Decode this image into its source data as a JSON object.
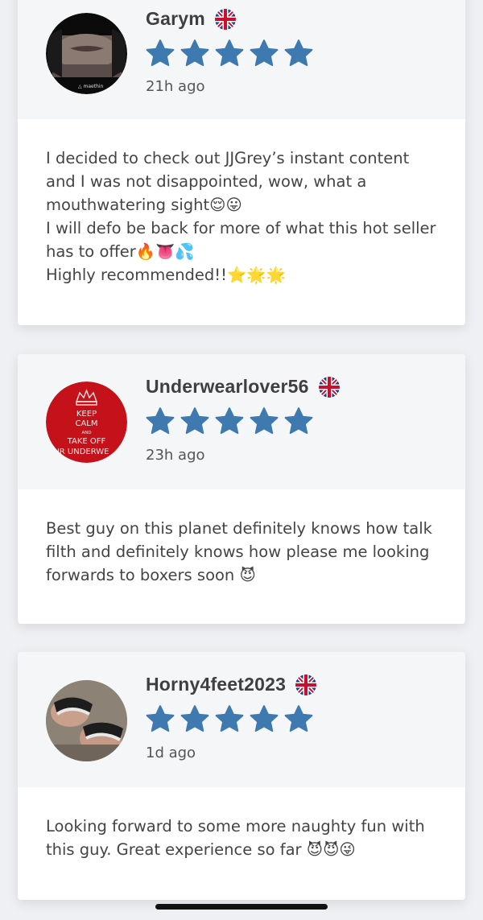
{
  "colors": {
    "star": "#3e7ab0",
    "username": "#3f3f3f",
    "header_bg": "#f5f6f8"
  },
  "reviews": [
    {
      "username": "Garym",
      "flag_icon": "uk-flag-icon",
      "rating": 5,
      "time": "21h ago",
      "avatar": "avatar-photo-face-icon",
      "text": "I decided to check out JJGrey’s instant content and I was not disappointed, wow, what a mouthwatering sight😌😛\nI will defo be back for more of what this hot seller has to offer🔥👅💦\nHighly recommended!!⭐🌟🌟"
    },
    {
      "username": "Underwearlover56",
      "flag_icon": "uk-flag-icon",
      "rating": 5,
      "time": "23h ago",
      "avatar": "avatar-keep-calm-icon",
      "avatar_lines": [
        "KEEP",
        "CALM",
        "AND",
        "TAKE OFF",
        "UR UNDERWE"
      ],
      "text": "Best guy on this planet definitely knows how talk filth and definitely knows how please me looking forwards to boxers soon 😈"
    },
    {
      "username": "Horny4feet2023",
      "flag_icon": "uk-flag-icon",
      "rating": 5,
      "time": "1d ago",
      "avatar": "avatar-photo-feet-icon",
      "text": "Looking forward to some more naughty fun with this guy. Great experience so far 😈😈😜"
    }
  ]
}
